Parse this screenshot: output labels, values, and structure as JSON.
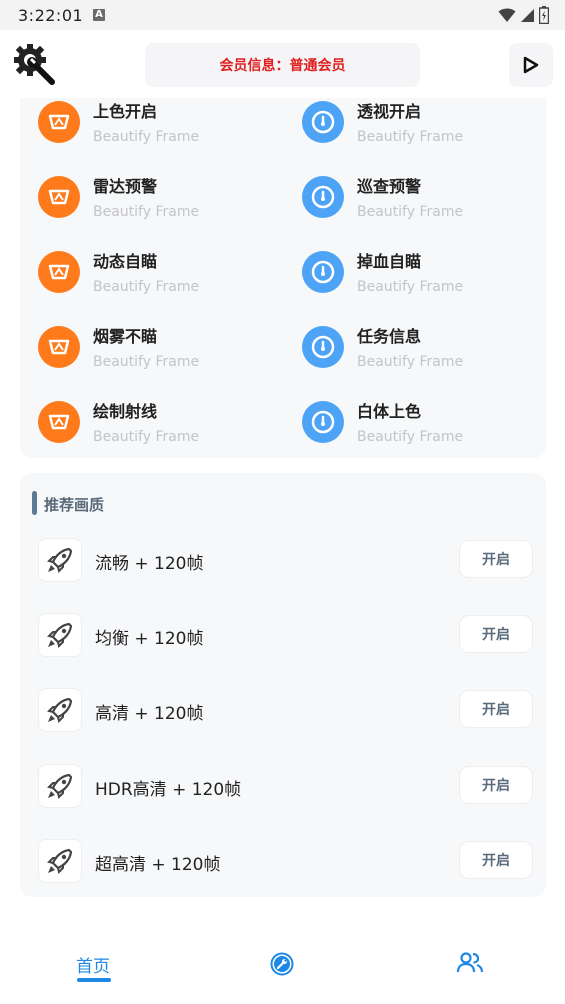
{
  "status_bar": {
    "time": "3:22:01",
    "notification_letter": "A"
  },
  "header": {
    "member_info": "会员信息：普通会员"
  },
  "features": [
    {
      "title": "上色开启",
      "subtitle": "Beautify Frame",
      "icon": "eye-badge-icon",
      "color": "#ff7a1a"
    },
    {
      "title": "透视开启",
      "subtitle": "Beautify Frame",
      "icon": "gauge-icon",
      "color": "#4da3f5"
    },
    {
      "title": "雷达预警",
      "subtitle": "Beautify Frame",
      "icon": "eye-badge-icon",
      "color": "#ff7a1a"
    },
    {
      "title": "巡查预警",
      "subtitle": "Beautify Frame",
      "icon": "gauge-icon",
      "color": "#4da3f5"
    },
    {
      "title": "动态自瞄",
      "subtitle": "Beautify Frame",
      "icon": "eye-badge-icon",
      "color": "#ff7a1a"
    },
    {
      "title": "掉血自瞄",
      "subtitle": "Beautify Frame",
      "icon": "gauge-icon",
      "color": "#4da3f5"
    },
    {
      "title": "烟雾不瞄",
      "subtitle": "Beautify Frame",
      "icon": "eye-badge-icon",
      "color": "#ff7a1a"
    },
    {
      "title": "任务信息",
      "subtitle": "Beautify Frame",
      "icon": "gauge-icon",
      "color": "#4da3f5"
    },
    {
      "title": "绘制射线",
      "subtitle": "Beautify Frame",
      "icon": "eye-badge-icon",
      "color": "#ff7a1a"
    },
    {
      "title": "白体上色",
      "subtitle": "Beautify Frame",
      "icon": "gauge-icon",
      "color": "#4da3f5"
    }
  ],
  "quality": {
    "section_title": "推荐画质",
    "items": [
      {
        "label": "流畅 + 120帧",
        "button": "开启"
      },
      {
        "label": "均衡 + 120帧",
        "button": "开启"
      },
      {
        "label": "高清 + 120帧",
        "button": "开启"
      },
      {
        "label": "HDR高清 + 120帧",
        "button": "开启"
      },
      {
        "label": "超高清 + 120帧",
        "button": "开启"
      }
    ]
  },
  "nav": {
    "home": "首页",
    "accent": "#1e88e5"
  }
}
